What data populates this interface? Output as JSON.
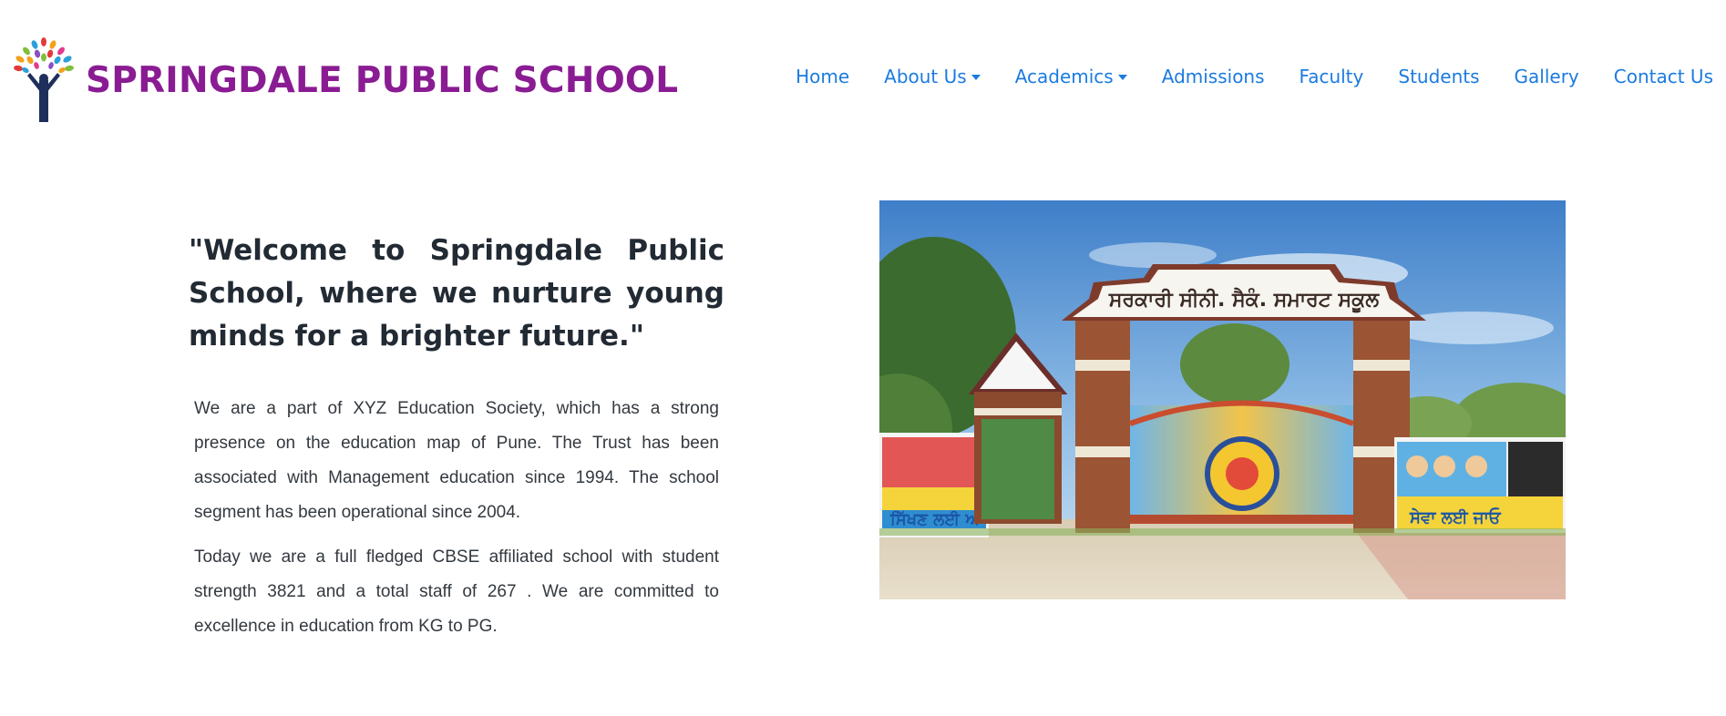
{
  "header": {
    "school_name": "SPRINGDALE PUBLIC SCHOOL",
    "logo_icon": "tree-people-logo-icon"
  },
  "nav": {
    "items": [
      {
        "label": "Home",
        "dropdown": false
      },
      {
        "label": "About Us",
        "dropdown": true
      },
      {
        "label": "Academics",
        "dropdown": true
      },
      {
        "label": "Admissions",
        "dropdown": false
      },
      {
        "label": "Faculty",
        "dropdown": false
      },
      {
        "label": "Students",
        "dropdown": false
      },
      {
        "label": "Gallery",
        "dropdown": false
      },
      {
        "label": "Contact Us",
        "dropdown": false
      }
    ]
  },
  "main": {
    "welcome_quote": "\"Welcome to Springdale Public School, where we nurture young minds for a brighter future.\"",
    "paragraphs": [
      "We are a part of XYZ Education Society, which has a strong presence on the education map of Pune. The Trust has been associated with Management education since 1994. The school segment has been operational since 2004.",
      "Today we are a full fledged CBSE affiliated school with student strength 3821 and a total staff of 267 . We are committed to excellence in education from KG to PG."
    ]
  },
  "photo": {
    "subject": "school-gate-photo"
  },
  "colors": {
    "brand_purple": "#8a1c93",
    "nav_blue": "#1b7be0",
    "heading_text": "#222a33",
    "body_text": "#33393f",
    "background": "#ffffff"
  }
}
